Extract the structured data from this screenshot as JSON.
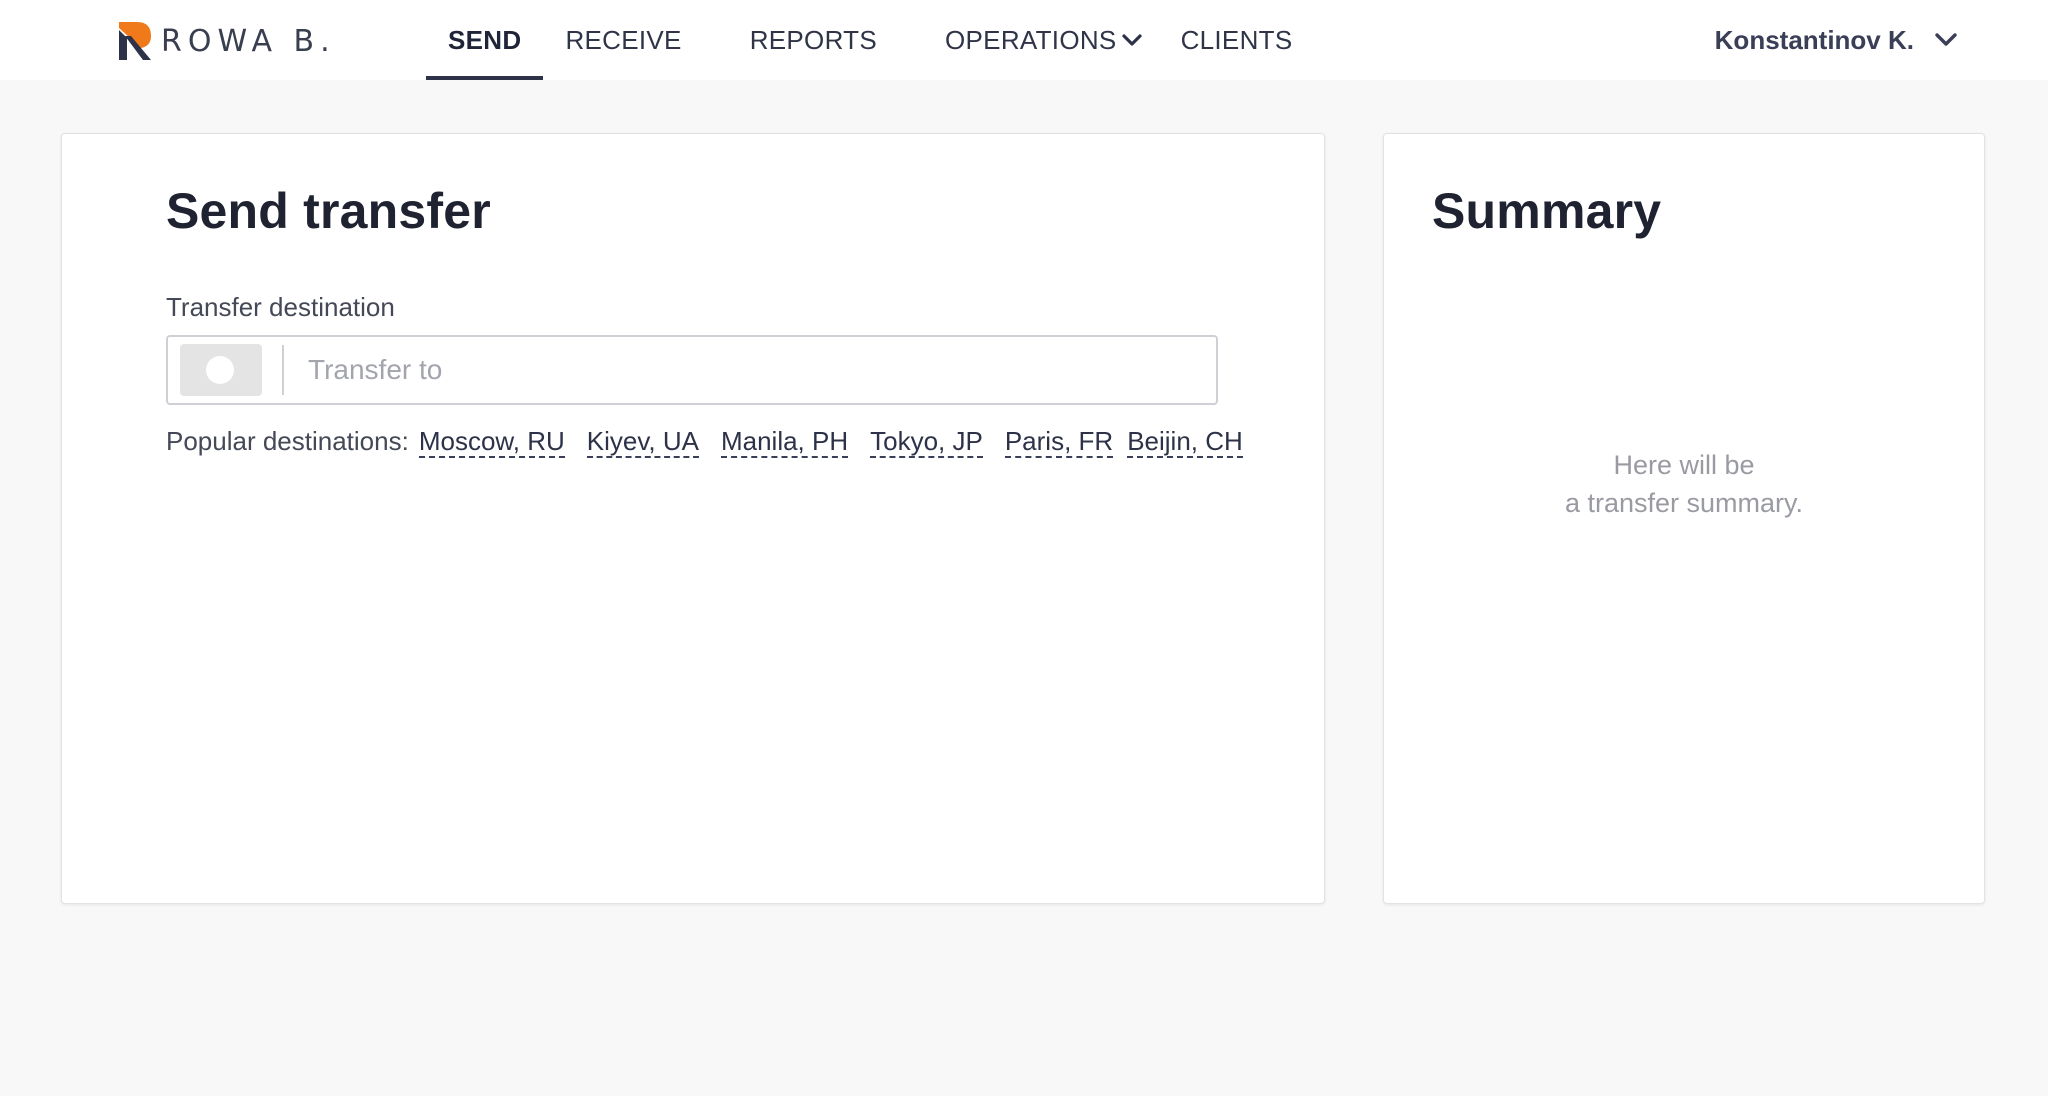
{
  "brand": {
    "name": "ROWA B.",
    "accent_orange": "#f07a1a",
    "accent_dark": "#2d3248"
  },
  "nav": {
    "items": [
      {
        "label": "SEND",
        "active": true
      },
      {
        "label": "RECEIVE",
        "active": false
      },
      {
        "label": "REPORTS",
        "active": false
      },
      {
        "label": "OPERATIONS",
        "active": false,
        "has_dropdown": true
      },
      {
        "label": "CLIENTS",
        "active": false
      }
    ]
  },
  "user": {
    "name": "Konstantinov K.",
    "icon": "chevron-down-icon"
  },
  "send_card": {
    "title": "Send transfer",
    "field_label": "Transfer destination",
    "input_placeholder": "Transfer to",
    "input_value": "",
    "popular_label": "Popular destinations:",
    "popular_destinations": [
      "Moscow, RU",
      "Kiyev, UA",
      "Manila, PH",
      "Tokyo, JP",
      "Paris, FR",
      "Beijin, CH"
    ]
  },
  "summary_card": {
    "title": "Summary",
    "placeholder_line1": "Here will be",
    "placeholder_line2": "a transfer summary."
  }
}
